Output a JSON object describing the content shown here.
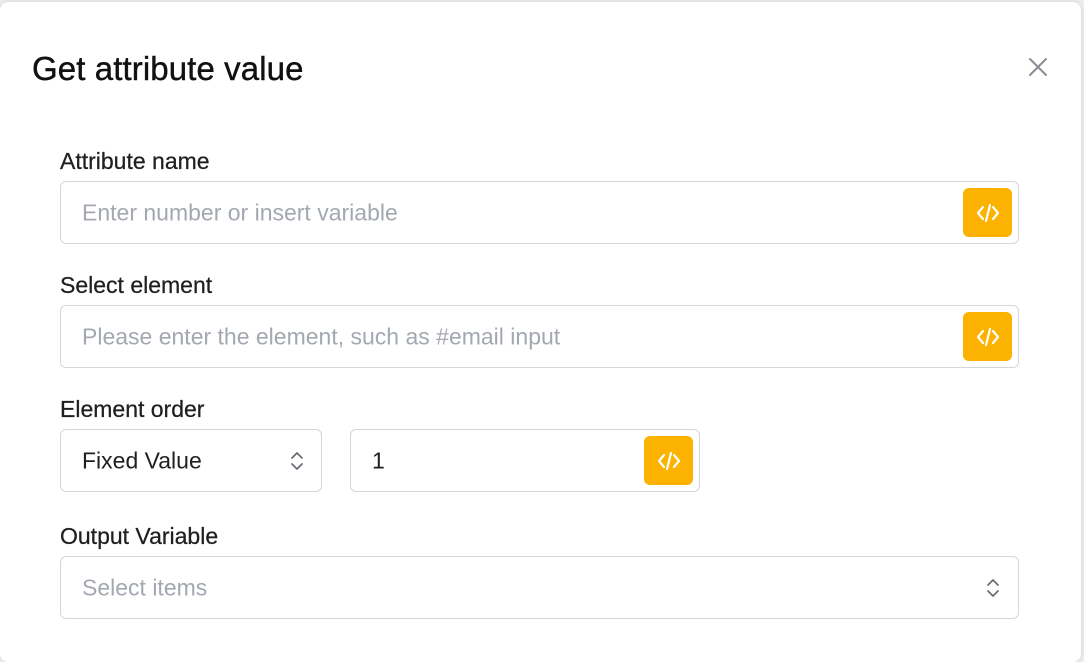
{
  "dialog": {
    "title": "Get attribute value",
    "close_icon": "close-icon"
  },
  "fields": {
    "attribute_name": {
      "label": "Attribute name",
      "placeholder": "Enter number or insert variable",
      "button_icon": "code-variable-icon"
    },
    "select_element": {
      "label": "Select element",
      "placeholder": "Please enter the element, such as #email input",
      "button_icon": "code-variable-icon"
    },
    "element_order": {
      "label": "Element order",
      "mode_value": "Fixed Value",
      "order_value": "1",
      "button_icon": "code-variable-icon"
    },
    "output_variable": {
      "label": "Output Variable",
      "placeholder": "Select items"
    }
  },
  "colors": {
    "accent": "#fbb200",
    "border": "#d4d6da",
    "placeholder": "#a3a8b0"
  }
}
